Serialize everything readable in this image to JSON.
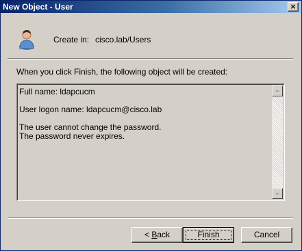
{
  "window": {
    "title": "New Object - User",
    "close_label": "×"
  },
  "header": {
    "icon": "user-icon",
    "create_label": "Create in:",
    "create_value": "cisco.lab/Users"
  },
  "info_text": "When you click Finish, the following object will be created:",
  "summary": {
    "full_name": "Full name: ldapcucm",
    "logon_name": "User logon name: ldapcucm@cisco.lab",
    "password_change": "The user cannot change the password.",
    "password_expiry": "The password never expires."
  },
  "buttons": {
    "back_prefix": "< ",
    "back_mnemonic": "B",
    "back_rest": "ack",
    "finish": "Finish",
    "cancel": "Cancel"
  }
}
